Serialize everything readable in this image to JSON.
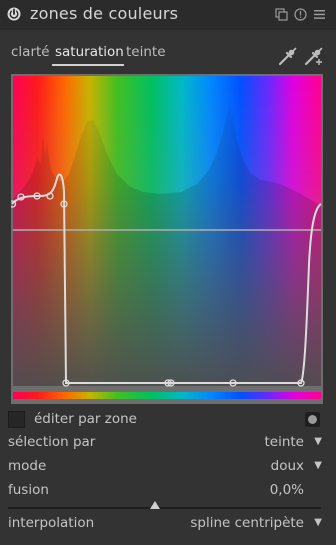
{
  "module": {
    "title": "zones de couleurs"
  },
  "tabs": [
    {
      "label": "clarté",
      "active": false
    },
    {
      "label": "saturation",
      "active": true
    },
    {
      "label": "teinte",
      "active": false
    }
  ],
  "controls": {
    "edit_by_zone": {
      "label": "éditer par zone",
      "checked": false
    },
    "selection": {
      "label": "sélection par",
      "value": "teinte"
    },
    "mode": {
      "label": "mode",
      "value": "doux"
    },
    "fusion": {
      "label": "fusion",
      "value": "0,0%",
      "slider_fraction": 0.47
    },
    "interpolation": {
      "label": "interpolation",
      "value": "spline centripète"
    }
  },
  "colors": {
    "accent": "#d0d0d0",
    "curve": "#dcdcdc",
    "background": "#333333",
    "header": "#2b2b2b"
  }
}
